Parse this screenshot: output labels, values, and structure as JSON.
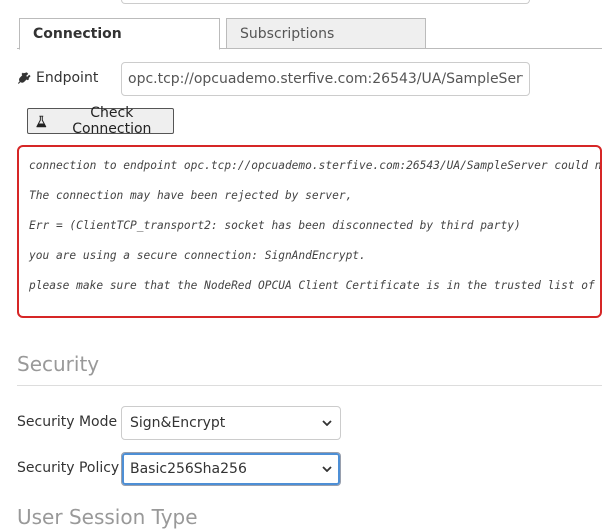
{
  "tabs": [
    {
      "label": "Connection",
      "active": true
    },
    {
      "label": "Subscriptions",
      "active": false
    }
  ],
  "endpoint": {
    "label": "Endpoint",
    "value": "opc.tcp://opcuademo.sterfive.com:26543/UA/SampleServer",
    "icon": "plug-icon"
  },
  "check_button": {
    "label": "Check Connection",
    "icon": "flask-icon"
  },
  "error": {
    "color": "#d62626",
    "lines": [
      "connection to endpoint opc.tcp://opcuademo.sterfive.com:26543/UA/SampleServer could n",
      "The connection may have been rejected by server,",
      "Err = (ClientTCP_transport2: socket has been disconnected by third party)",
      "you are using a secure connection: SignAndEncrypt.",
      "please make sure that the NodeRed OPCUA Client Certificate is in the trusted list of"
    ]
  },
  "security": {
    "title": "Security",
    "mode": {
      "label": "Security Mode",
      "value": "Sign&Encrypt"
    },
    "policy": {
      "label": "Security Policy",
      "value": "Basic256Sha256"
    }
  },
  "user_session": {
    "title": "User Session Type"
  }
}
